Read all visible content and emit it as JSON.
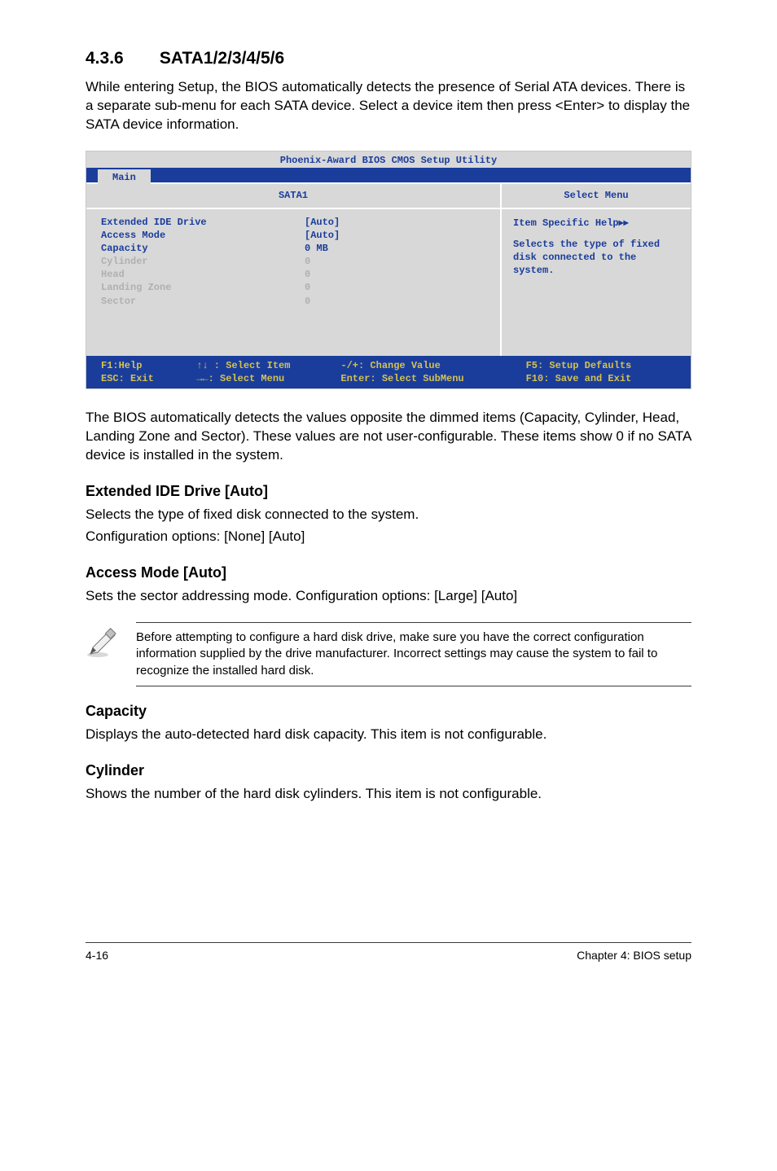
{
  "heading": {
    "num": "4.3.6",
    "title": "SATA1/2/3/4/5/6"
  },
  "intro": "While entering Setup, the BIOS automatically detects the presence of Serial ATA devices. There is a separate sub-menu for each SATA device. Select a device item then press <Enter> to display the SATA device information.",
  "bios": {
    "title": "Phoenix-Award BIOS CMOS Setup Utility",
    "tab": "Main",
    "left_header": "SATA1",
    "right_header": "Select Menu",
    "rows": [
      {
        "label": "Extended IDE Drive",
        "value": "[Auto]",
        "dim": false
      },
      {
        "label": "Access Mode",
        "value": "[Auto]",
        "dim": false
      },
      {
        "label": "",
        "value": "",
        "dim": false
      },
      {
        "label": "Capacity",
        "value": "0 MB",
        "dim": false
      },
      {
        "label": "",
        "value": "",
        "dim": false
      },
      {
        "label": "Cylinder",
        "value": "0",
        "dim": true
      },
      {
        "label": "Head",
        "value": "0",
        "dim": true
      },
      {
        "label": "Landing Zone",
        "value": "0",
        "dim": true
      },
      {
        "label": "Sector",
        "value": "0",
        "dim": true
      }
    ],
    "help_title": "Item Specific Help",
    "help_body": "Selects the type of fixed disk connected to the system.",
    "footer": {
      "c1a": "F1:Help",
      "c1b": "ESC: Exit",
      "c2a": "↑↓ : Select Item",
      "c2b": "→←: Select Menu",
      "c3a": "-/+: Change Value",
      "c3b": "Enter: Select SubMenu",
      "c4a": "F5: Setup Defaults",
      "c4b": "F10: Save and Exit"
    }
  },
  "after_bios": "The BIOS automatically detects the values opposite the dimmed items (Capacity, Cylinder,  Head, Landing Zone and Sector). These values are not user-configurable. These items show 0 if no SATA device is installed in the system.",
  "sections": {
    "ext": {
      "title": "Extended IDE Drive [Auto]",
      "p1": "Selects the type of fixed disk connected to the system.",
      "p2": "Configuration options: [None] [Auto]"
    },
    "access": {
      "title": "Access Mode [Auto]",
      "p1": "Sets the sector addressing mode. Configuration options: [Large] [Auto]"
    },
    "note": "Before attempting to configure a hard disk drive, make sure you have the correct configuration information supplied by the drive manufacturer. Incorrect settings may cause the system to fail to recognize the installed hard disk.",
    "capacity": {
      "title": "Capacity",
      "p1": "Displays the auto-detected hard disk capacity. This item is not configurable."
    },
    "cylinder": {
      "title": "Cylinder",
      "p1": "Shows the number of the hard disk cylinders. This item is not configurable."
    }
  },
  "footer": {
    "left": "4-16",
    "right": "Chapter 4: BIOS setup"
  }
}
